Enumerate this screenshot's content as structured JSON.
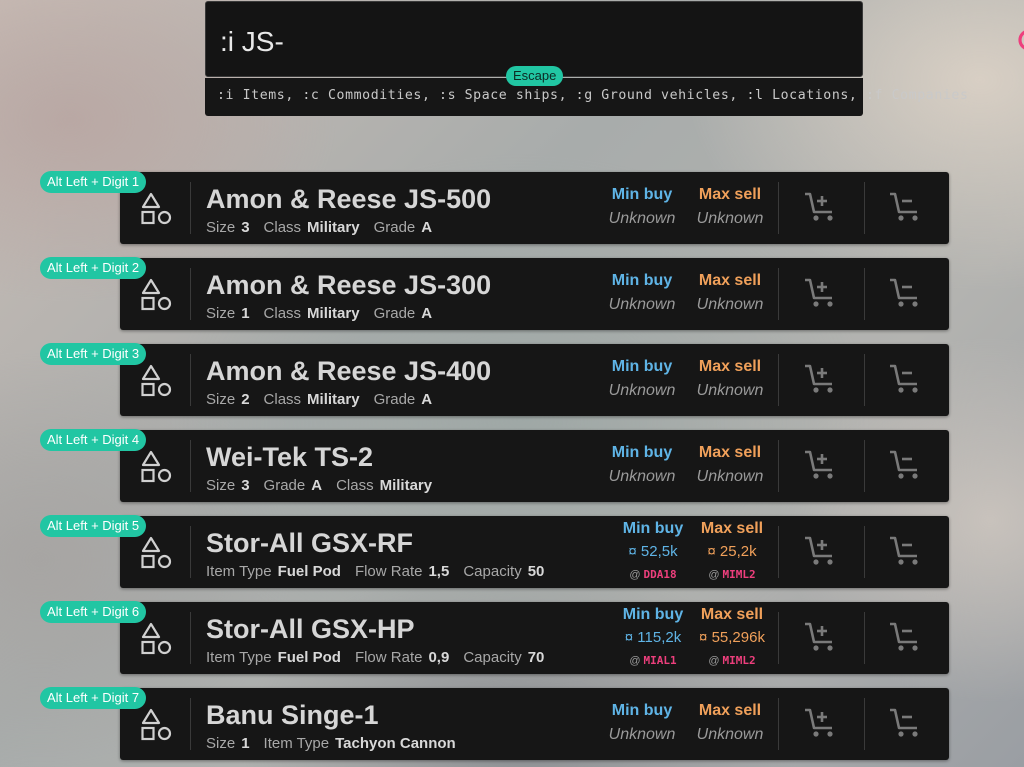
{
  "search": {
    "value": ":i JS-",
    "escape_badge": "Escape",
    "hint": ":i Items, :c Commodities, :s Space ships, :g Ground vehicles, :l Locations, :f Companies"
  },
  "colors": {
    "accent": "#21c6a3",
    "buy": "#5fb4e6",
    "sell": "#f0a05a",
    "highlight": "#ee3f7d"
  },
  "labels": {
    "min_buy": "Min buy",
    "max_sell": "Max sell",
    "currency": "¤",
    "at": "@"
  },
  "icons": {
    "type": "shapes-icon",
    "buy": "cart-add-icon",
    "sell": "cart-remove-icon",
    "search": "search-icon"
  },
  "results": [
    {
      "shortcut": "Alt Left + Digit 1",
      "name": "Amon & Reese JS-500",
      "attrs": [
        {
          "label": "Size",
          "value": "3"
        },
        {
          "label": "Class",
          "value": "Military"
        },
        {
          "label": "Grade",
          "value": "A"
        }
      ],
      "min_buy": "Unknown",
      "max_sell": "Unknown"
    },
    {
      "shortcut": "Alt Left + Digit 2",
      "name": "Amon & Reese JS-300",
      "attrs": [
        {
          "label": "Size",
          "value": "1"
        },
        {
          "label": "Class",
          "value": "Military"
        },
        {
          "label": "Grade",
          "value": "A"
        }
      ],
      "min_buy": "Unknown",
      "max_sell": "Unknown"
    },
    {
      "shortcut": "Alt Left + Digit 3",
      "name": "Amon & Reese JS-400",
      "attrs": [
        {
          "label": "Size",
          "value": "2"
        },
        {
          "label": "Class",
          "value": "Military"
        },
        {
          "label": "Grade",
          "value": "A"
        }
      ],
      "min_buy": "Unknown",
      "max_sell": "Unknown"
    },
    {
      "shortcut": "Alt Left + Digit 4",
      "name": "Wei-Tek TS-2",
      "attrs": [
        {
          "label": "Size",
          "value": "3"
        },
        {
          "label": "Grade",
          "value": "A"
        },
        {
          "label": "Class",
          "value": "Military"
        }
      ],
      "min_buy": "Unknown",
      "max_sell": "Unknown"
    },
    {
      "shortcut": "Alt Left + Digit 5",
      "name": "Stor-All GSX-RF",
      "attrs": [
        {
          "label": "Item Type",
          "value": "Fuel Pod"
        },
        {
          "label": "Flow Rate",
          "value": "1,5"
        },
        {
          "label": "Capacity",
          "value": "50"
        }
      ],
      "min_buy": "52,5k",
      "min_buy_loc": "DDA18",
      "max_sell": "25,2k",
      "max_sell_loc": "MIML2"
    },
    {
      "shortcut": "Alt Left + Digit 6",
      "name": "Stor-All GSX-HP",
      "attrs": [
        {
          "label": "Item Type",
          "value": "Fuel Pod"
        },
        {
          "label": "Flow Rate",
          "value": "0,9"
        },
        {
          "label": "Capacity",
          "value": "70"
        }
      ],
      "min_buy": "115,2k",
      "min_buy_loc": "MIAL1",
      "max_sell": "55,296k",
      "max_sell_loc": "MIML2"
    },
    {
      "shortcut": "Alt Left + Digit 7",
      "name": "Banu Singe-1",
      "attrs": [
        {
          "label": "Size",
          "value": "1"
        },
        {
          "label": "Item Type",
          "value": "Tachyon Cannon"
        }
      ],
      "min_buy": "Unknown",
      "max_sell": "Unknown"
    }
  ]
}
